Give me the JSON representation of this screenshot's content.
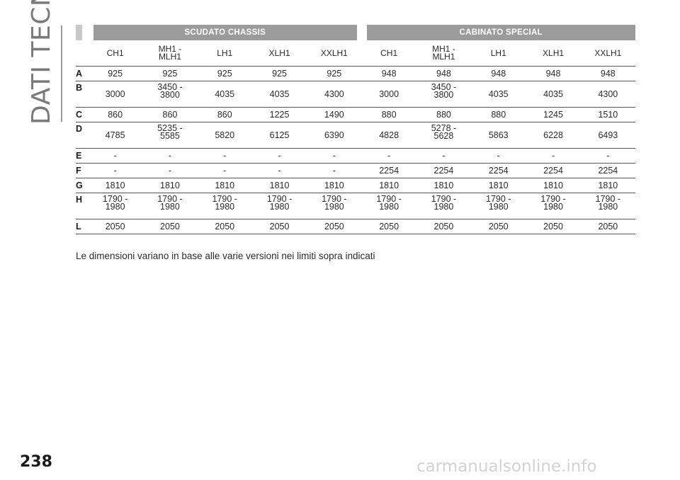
{
  "section_title": "DATI TECNICI",
  "page_number": "238",
  "watermark": "carmanualsonline.info",
  "table": {
    "groups": [
      "SCUDATO CHASSIS",
      "CABINATO SPECIAL"
    ],
    "columns": [
      "CH1",
      "MH1 -\nMLH1",
      "LH1",
      "XLH1",
      "XXLH1",
      "CH1",
      "MH1 -\nMLH1",
      "LH1",
      "XLH1",
      "XXLH1"
    ],
    "rows": [
      {
        "label": "A",
        "values": [
          "925",
          "925",
          "925",
          "925",
          "925",
          "948",
          "948",
          "948",
          "948",
          "948"
        ]
      },
      {
        "label": "B",
        "values": [
          "3000",
          "3450 -\n3800",
          "4035",
          "4035",
          "4300",
          "3000",
          "3450 -\n3800",
          "4035",
          "4035",
          "4300"
        ]
      },
      {
        "label": "C",
        "values": [
          "860",
          "860",
          "860",
          "1225",
          "1490",
          "880",
          "880",
          "880",
          "1245",
          "1510"
        ]
      },
      {
        "label": "D",
        "values": [
          "4785",
          "5235 -\n5585",
          "5820",
          "6125",
          "6390",
          "4828",
          "5278 -\n5628",
          "5863",
          "6228",
          "6493"
        ]
      },
      {
        "label": "E",
        "values": [
          "-",
          "-",
          "-",
          "-",
          "-",
          "-",
          "-",
          "-",
          "-",
          "-"
        ]
      },
      {
        "label": "F",
        "values": [
          "-",
          "-",
          "-",
          "-",
          "-",
          "2254",
          "2254",
          "2254",
          "2254",
          "2254"
        ]
      },
      {
        "label": "G",
        "values": [
          "1810",
          "1810",
          "1810",
          "1810",
          "1810",
          "1810",
          "1810",
          "1810",
          "1810",
          "1810"
        ]
      },
      {
        "label": "H",
        "values": [
          "1790 -\n1980",
          "1790 -\n1980",
          "1790 -\n1980",
          "1790 -\n1980",
          "1790 -\n1980",
          "1790 -\n1980",
          "1790 -\n1980",
          "1790 -\n1980",
          "1790 -\n1980",
          "1790 -\n1980"
        ]
      },
      {
        "label": "L",
        "values": [
          "2050",
          "2050",
          "2050",
          "2050",
          "2050",
          "2050",
          "2050",
          "2050",
          "2050",
          "2050"
        ]
      }
    ]
  },
  "note": "Le dimensioni variano in base alle varie versioni nei limiti sopra indicati",
  "colors": {
    "header_dark": "#9b9b9b",
    "header_light": "#c9c9c9",
    "side_title": "#7a7a7a"
  }
}
